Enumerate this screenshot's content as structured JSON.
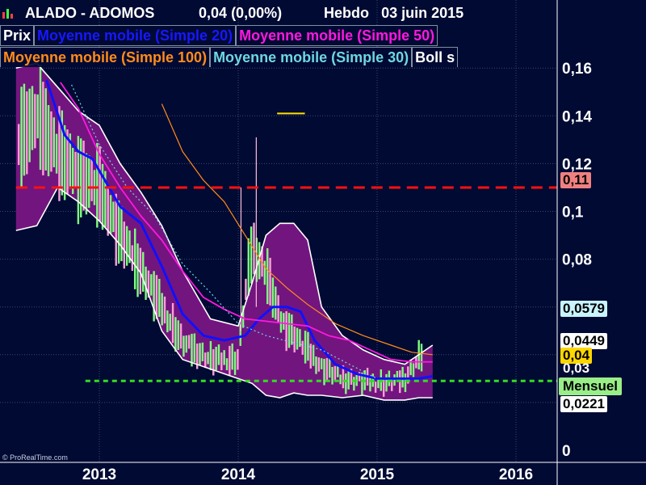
{
  "header": {
    "symbol": "ALADO - ADOMOS",
    "price_change": "0,04 (0,00%)",
    "timeframe": "Hebdo",
    "date": "03 juin 2015"
  },
  "legend": {
    "price": "Prix",
    "sma20": "Moyenne mobile (Simple 20)",
    "sma50": "Moyenne mobile (Simple 50)",
    "sma100": "Moyenne mobile (Simple 100)",
    "sma30": "Moyenne mobile (Simple 30)",
    "boll": "Boll s"
  },
  "watermark": "© ProRealTime.com",
  "badges": {
    "resistance": "0,11",
    "sma30": "0,0579",
    "upper": "0,0449",
    "price": "0,04",
    "mid": "0,03",
    "lower": "0,0221",
    "support_label": "Mensuel"
  },
  "colors": {
    "background": "#000a33",
    "band_fill": "#73157f",
    "band_edge": "#ffffff",
    "sma20": "#1010ff",
    "sma50": "#ff18e0",
    "sma100": "#ff8c1a",
    "sma30": "#6fd7e0",
    "resistance": "#ff1010",
    "support": "#33dd22",
    "up": "#80ff80",
    "down": "#ff9ed8"
  },
  "chart_data": {
    "type": "line",
    "x_axis": {
      "ticks": [
        "2013",
        "2014",
        "2015",
        "2016"
      ],
      "range": [
        2012.4,
        2016.3
      ]
    },
    "y_axis": {
      "ticks": [
        "0",
        "0,02",
        "0,04",
        "0,06",
        "0,08",
        "0,1",
        "0,12",
        "0,14",
        "0,16"
      ],
      "range": [
        0,
        0.165
      ]
    },
    "grid": true,
    "legend_position": "top-left",
    "series": [
      {
        "name": "Moyenne mobile (Simple 20)",
        "x": [
          2012.62,
          2012.75,
          2012.85,
          2012.95,
          2013.05,
          2013.15,
          2013.3,
          2013.45,
          2013.6,
          2013.75,
          2013.9,
          2014.05,
          2014.15,
          2014.25,
          2014.35,
          2014.45,
          2014.55,
          2014.7,
          2014.85,
          2015.0,
          2015.15,
          2015.3,
          2015.4
        ],
        "y": [
          0.155,
          0.132,
          0.125,
          0.122,
          0.112,
          0.102,
          0.095,
          0.077,
          0.057,
          0.048,
          0.046,
          0.048,
          0.055,
          0.06,
          0.06,
          0.058,
          0.046,
          0.036,
          0.032,
          0.03,
          0.03,
          0.03,
          0.031
        ]
      },
      {
        "name": "Moyenne mobile (Simple 50)",
        "x": [
          2012.72,
          2012.85,
          2013.0,
          2013.15,
          2013.3,
          2013.45,
          2013.6,
          2013.75,
          2013.9,
          2014.05,
          2014.2,
          2014.35,
          2014.5,
          2014.65,
          2014.8,
          2014.95,
          2015.1,
          2015.25,
          2015.4
        ],
        "y": [
          0.154,
          0.143,
          0.124,
          0.11,
          0.098,
          0.088,
          0.075,
          0.064,
          0.059,
          0.055,
          0.054,
          0.053,
          0.052,
          0.048,
          0.046,
          0.042,
          0.038,
          0.037,
          0.037
        ]
      },
      {
        "name": "Moyenne mobile (Simple 100)",
        "x": [
          2013.45,
          2013.6,
          2013.75,
          2013.9,
          2014.05,
          2014.2,
          2014.35,
          2014.5,
          2014.7,
          2014.9,
          2015.1,
          2015.25,
          2015.4
        ],
        "y": [
          0.145,
          0.125,
          0.113,
          0.104,
          0.09,
          0.076,
          0.068,
          0.061,
          0.053,
          0.048,
          0.044,
          0.041,
          0.04
        ]
      },
      {
        "name": "Moyenne mobile (Simple 30)",
        "x": [
          2012.8,
          2013.0,
          2013.2,
          2013.4,
          2013.6,
          2013.8,
          2014.0,
          2014.2,
          2014.4,
          2014.6,
          2014.8,
          2015.0
        ],
        "y": [
          0.153,
          0.128,
          0.11,
          0.098,
          0.078,
          0.066,
          0.053,
          0.048,
          0.045,
          0.042,
          0.036,
          0.03
        ]
      },
      {
        "name": "Boll upper",
        "x": [
          2012.4,
          2012.55,
          2012.7,
          2012.85,
          2013.0,
          2013.15,
          2013.3,
          2013.45,
          2013.6,
          2013.8,
          2014.0,
          2014.1,
          2014.2,
          2014.3,
          2014.4,
          2014.5,
          2014.6,
          2014.75,
          2014.9,
          2015.05,
          2015.2,
          2015.3,
          2015.4
        ],
        "y": [
          0.16,
          0.162,
          0.152,
          0.142,
          0.136,
          0.12,
          0.108,
          0.094,
          0.075,
          0.055,
          0.052,
          0.07,
          0.09,
          0.095,
          0.095,
          0.088,
          0.06,
          0.048,
          0.042,
          0.038,
          0.036,
          0.04,
          0.044
        ]
      },
      {
        "name": "Boll lower",
        "x": [
          2012.4,
          2012.55,
          2012.7,
          2012.85,
          2013.0,
          2013.15,
          2013.3,
          2013.45,
          2013.6,
          2013.8,
          2014.0,
          2014.1,
          2014.2,
          2014.3,
          2014.4,
          2014.5,
          2014.6,
          2014.75,
          2014.9,
          2015.05,
          2015.2,
          2015.3,
          2015.4
        ],
        "y": [
          0.092,
          0.094,
          0.11,
          0.104,
          0.096,
          0.086,
          0.074,
          0.05,
          0.038,
          0.034,
          0.03,
          0.028,
          0.023,
          0.022,
          0.024,
          0.023,
          0.023,
          0.022,
          0.023,
          0.021,
          0.021,
          0.022,
          0.022
        ]
      }
    ],
    "price_bars": {
      "x_start": 2012.42,
      "x_end": 2015.32,
      "anchors": [
        [
          2012.42,
          0.13
        ],
        [
          2012.55,
          0.14
        ],
        [
          2012.7,
          0.125
        ],
        [
          2012.85,
          0.115
        ],
        [
          2013.0,
          0.11
        ],
        [
          2013.15,
          0.09
        ],
        [
          2013.3,
          0.075
        ],
        [
          2013.45,
          0.06
        ],
        [
          2013.6,
          0.045
        ],
        [
          2013.8,
          0.038
        ],
        [
          2014.0,
          0.038
        ],
        [
          2014.05,
          0.065
        ],
        [
          2014.1,
          0.085
        ],
        [
          2014.2,
          0.075
        ],
        [
          2014.3,
          0.055
        ],
        [
          2014.45,
          0.045
        ],
        [
          2014.6,
          0.035
        ],
        [
          2014.75,
          0.03
        ],
        [
          2014.9,
          0.029
        ],
        [
          2015.05,
          0.028
        ],
        [
          2015.2,
          0.03
        ],
        [
          2015.32,
          0.04
        ]
      ],
      "count": 150
    },
    "spikes": [
      {
        "x": 2014.02,
        "y_low": 0.05,
        "y_high": 0.11
      },
      {
        "x": 2014.13,
        "y_low": 0.06,
        "y_high": 0.131
      }
    ],
    "yellow_mark": {
      "x": [
        2014.28,
        2014.48
      ],
      "y": 0.141
    },
    "hlines": [
      {
        "name": "resistance",
        "y": 0.11,
        "x_from": 2012.4,
        "x_to": 2016.3
      },
      {
        "name": "support",
        "y": 0.029,
        "x_from": 2012.9,
        "x_to": 2016.3
      }
    ]
  }
}
